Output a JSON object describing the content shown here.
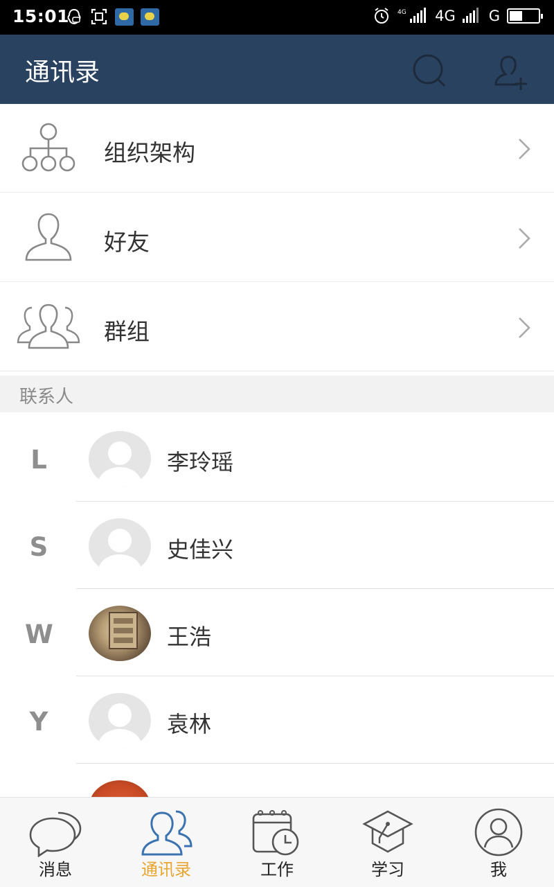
{
  "status_bar": {
    "time": "15:01",
    "network_1": "4G",
    "network_2": "G",
    "battery_level": 0.45
  },
  "header": {
    "title": "通讯录"
  },
  "menu": [
    {
      "label": "组织架构",
      "icon": "org-chart-icon"
    },
    {
      "label": "好友",
      "icon": "person-icon"
    },
    {
      "label": "群组",
      "icon": "group-icon"
    }
  ],
  "section": {
    "title": "联系人"
  },
  "contacts": [
    {
      "letter": "L",
      "name": "李玲瑶",
      "avatar": "default-avatar"
    },
    {
      "letter": "S",
      "name": "史佳兴",
      "avatar": "default-avatar"
    },
    {
      "letter": "W",
      "name": "王浩",
      "avatar": "photo-avatar"
    },
    {
      "letter": "Y",
      "name": "袁林",
      "avatar": "default-avatar"
    }
  ],
  "tabs": [
    {
      "label": "消息",
      "icon": "chat-bubbles-icon",
      "active": false
    },
    {
      "label": "通讯录",
      "icon": "contacts-icon",
      "active": true
    },
    {
      "label": "工作",
      "icon": "calendar-clock-icon",
      "active": false
    },
    {
      "label": "学习",
      "icon": "graduation-cap-icon",
      "active": false
    },
    {
      "label": "我",
      "icon": "profile-icon",
      "active": false
    }
  ],
  "colors": {
    "header_bg": "#294260",
    "active_tab": "#e8a631",
    "section_bg": "#f2f2f2"
  }
}
